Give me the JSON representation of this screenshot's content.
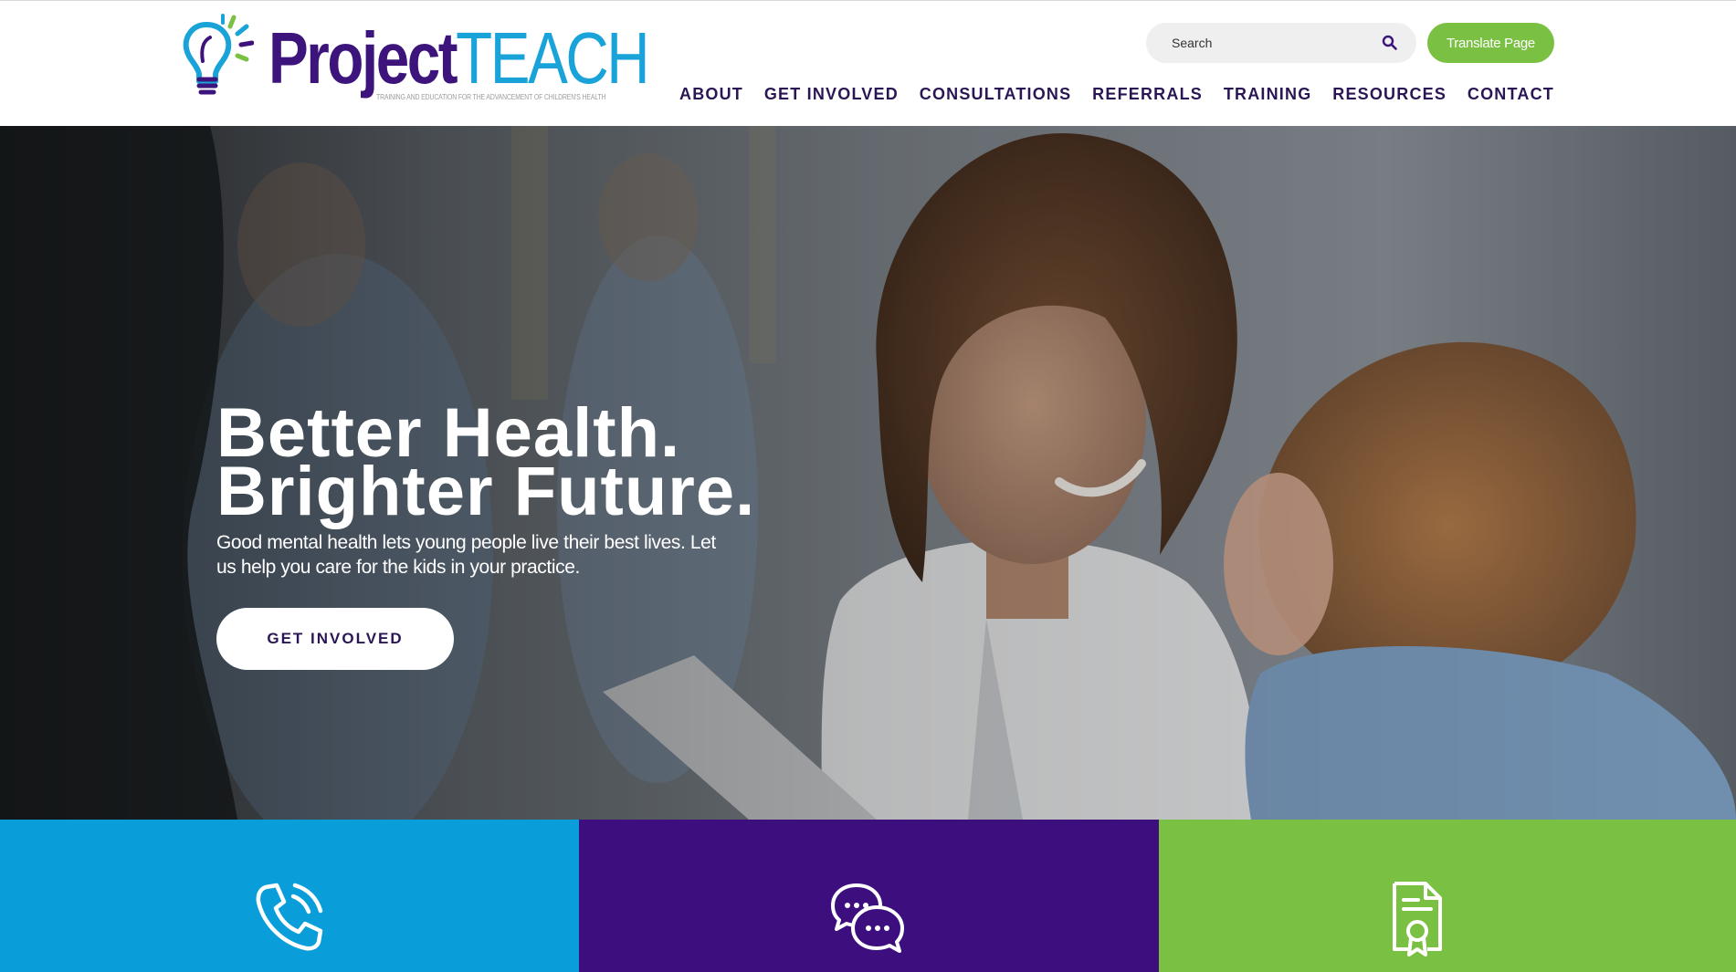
{
  "brand": {
    "name_part1": "Project",
    "name_part2": "TEACH",
    "tagline": "TRAINING AND EDUCATION FOR THE ADVANCEMENT OF CHILDREN'S HEALTH",
    "icon": "lightbulb-icon"
  },
  "search": {
    "placeholder": "Search",
    "icon": "search-icon"
  },
  "translate": {
    "label": "Translate Page"
  },
  "nav": {
    "items": [
      {
        "label": "ABOUT"
      },
      {
        "label": "GET INVOLVED"
      },
      {
        "label": "CONSULTATIONS"
      },
      {
        "label": "REFERRALS"
      },
      {
        "label": "TRAINING"
      },
      {
        "label": "RESOURCES"
      },
      {
        "label": "CONTACT"
      }
    ]
  },
  "hero": {
    "title_line1": "Better Health.",
    "title_line2": "Brighter Future.",
    "subtitle": "Good mental health lets young people live their best lives. Let us help you care for the kids in your practice.",
    "cta_label": "GET INVOLVED"
  },
  "tiles": [
    {
      "icon": "phone-icon"
    },
    {
      "icon": "chat-bubbles-icon"
    },
    {
      "icon": "certificate-document-icon"
    }
  ],
  "colors": {
    "brand_purple": "#3d147c",
    "brand_blue": "#1aa3d9",
    "brand_green": "#7ac143",
    "nav_text": "#2b1655",
    "tile_blue": "#099ed9",
    "tile_purple": "#3d0f7e",
    "tile_green": "#7ac143"
  }
}
